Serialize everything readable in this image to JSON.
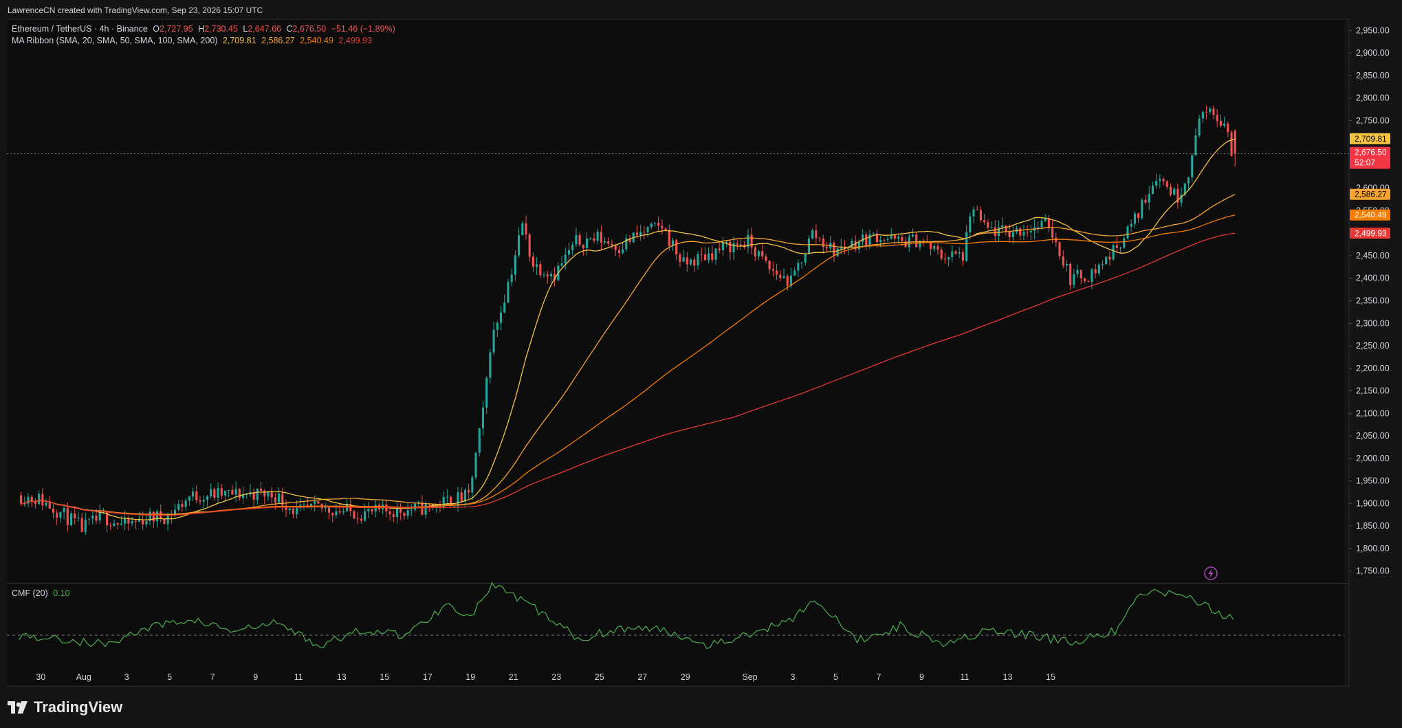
{
  "header": {
    "attribution": "LawrenceCN created with TradingView.com, Sep 23, 2026 15:07 UTC"
  },
  "legend": {
    "symbol": "Ethereum / TetherUS · 4h · Binance",
    "o_label": "O",
    "o_value": "2,727.95",
    "h_label": "H",
    "h_value": "2,730.45",
    "l_label": "L",
    "l_value": "2,647.66",
    "c_label": "C",
    "c_value": "2,676.50",
    "change": "−51.46 (−1.89%)",
    "ma_label": "MA Ribbon (SMA, 20, SMA, 50, SMA, 100, SMA, 200)",
    "ma_values": [
      "2,709.81",
      "2,586.27",
      "2,540.49",
      "2,499.93"
    ],
    "cmf_label": "CMF (20)",
    "cmf_value": "0.10"
  },
  "price_axis": {
    "ticks": [
      "2,950.00",
      "2,900.00",
      "2,850.00",
      "2,800.00",
      "2,750.00",
      "2,600.00",
      "2,550.00",
      "2,500.00",
      "2,450.00",
      "2,400.00",
      "2,350.00",
      "2,300.00",
      "2,250.00",
      "2,200.00",
      "2,150.00",
      "2,100.00",
      "2,050.00",
      "2,000.00",
      "1,950.00",
      "1,900.00",
      "1,850.00",
      "1,800.00",
      "1,750.00"
    ],
    "badges": [
      {
        "label": "2,709.81",
        "color": "#f5c542",
        "text_color": "#000000",
        "value": 2709.81
      },
      {
        "label": "2,676.50",
        "sub": "52:07",
        "color": "#f23645",
        "text_color": "#ffffff",
        "value": 2676.5
      },
      {
        "label": "2,586.27",
        "color": "#f7a530",
        "text_color": "#000000",
        "value": 2586.27
      },
      {
        "label": "2,540.49",
        "color": "#f57c00",
        "text_color": "#ffffff",
        "value": 2540.49
      },
      {
        "label": "2,499.93",
        "color": "#e53935",
        "text_color": "#ffffff",
        "value": 2499.93
      }
    ]
  },
  "time_axis": {
    "ticks": [
      "30",
      "Aug",
      "3",
      "5",
      "7",
      "9",
      "11",
      "13",
      "15",
      "17",
      "19",
      "21",
      "23",
      "25",
      "27",
      "29",
      "Sep",
      "3",
      "5",
      "7",
      "9",
      "11",
      "13",
      "15"
    ]
  },
  "branding": {
    "name": "TradingView"
  },
  "colors": {
    "up": "#26a69a",
    "down": "#ef5350",
    "sma20": "#f5c542",
    "sma50": "#f7a530",
    "sma100": "#f57c00",
    "sma200": "#e53935",
    "cmf": "#4caf50"
  },
  "chart_data": {
    "type": "candlestick",
    "symbol": "ETHUSDT",
    "interval": "4h",
    "ylim": [
      1725,
      2975
    ],
    "x_range": [
      "Jul 29",
      "Sep 23"
    ],
    "price_path": [
      [
        "Jul 29 00:00",
        1918
      ],
      [
        "Jul 30 00:00",
        1910
      ],
      [
        "Jul 31 00:00",
        1880
      ],
      [
        "Aug 1 00:00",
        1845
      ],
      [
        "Aug 2 00:00",
        1870
      ],
      [
        "Aug 3 00:00",
        1850
      ],
      [
        "Aug 4 00:00",
        1868
      ],
      [
        "Aug 5 00:00",
        1872
      ],
      [
        "Aug 6 00:00",
        1915
      ],
      [
        "Aug 7 00:00",
        1920
      ],
      [
        "Aug 8 00:00",
        1920
      ],
      [
        "Aug 9 00:00",
        1922
      ],
      [
        "Aug 10 00:00",
        1918
      ],
      [
        "Aug 11 00:00",
        1880
      ],
      [
        "Aug 12 00:00",
        1890
      ],
      [
        "Aug 13 00:00",
        1885
      ],
      [
        "Aug 14 00:00",
        1878
      ],
      [
        "Aug 15 00:00",
        1882
      ],
      [
        "Aug 16 00:00",
        1885
      ],
      [
        "Aug 17 00:00",
        1890
      ],
      [
        "Aug 18 00:00",
        1905
      ],
      [
        "Aug 19 00:00",
        1915
      ],
      [
        "Aug 19 16:00",
        2100
      ],
      [
        "Aug 20 00:00",
        2250
      ],
      [
        "Aug 20 16:00",
        2360
      ],
      [
        "Aug 21 00:00",
        2420
      ],
      [
        "Aug 21 12:00",
        2520
      ],
      [
        "Aug 22 00:00",
        2430
      ],
      [
        "Aug 23 00:00",
        2410
      ],
      [
        "Aug 24 00:00",
        2480
      ],
      [
        "Aug 25 00:00",
        2490
      ],
      [
        "Aug 26 00:00",
        2470
      ],
      [
        "Aug 27 00:00",
        2500
      ],
      [
        "Aug 28 00:00",
        2515
      ],
      [
        "Aug 29 00:00",
        2430
      ],
      [
        "Aug 30 00:00",
        2450
      ],
      [
        "Aug 31 00:00",
        2470
      ],
      [
        "Sep 1 00:00",
        2480
      ],
      [
        "Sep 2 00:00",
        2420
      ],
      [
        "Sep 3 00:00",
        2390
      ],
      [
        "Sep 4 00:00",
        2500
      ],
      [
        "Sep 5 00:00",
        2460
      ],
      [
        "Sep 6 00:00",
        2480
      ],
      [
        "Sep 7 00:00",
        2495
      ],
      [
        "Sep 8 00:00",
        2480
      ],
      [
        "Sep 9 00:00",
        2485
      ],
      [
        "Sep 10 00:00",
        2450
      ],
      [
        "Sep 11 00:00",
        2450
      ],
      [
        "Sep 11 12:00",
        2560
      ],
      [
        "Sep 12 00:00",
        2510
      ],
      [
        "Sep 13 00:00",
        2500
      ],
      [
        "Sep 14 00:00",
        2510
      ],
      [
        "Sep 15 00:00",
        2520
      ],
      [
        "Sep 16 00:00",
        2400
      ],
      [
        "Sep 17 00:00",
        2410
      ],
      [
        "Sep 18 00:00",
        2460
      ],
      [
        "Sep 19 00:00",
        2530
      ],
      [
        "Sep 20 00:00",
        2630
      ],
      [
        "Sep 21 00:00",
        2580
      ],
      [
        "Sep 21 16:00",
        2660
      ],
      [
        "Sep 22 00:00",
        2770
      ],
      [
        "Sep 23 00:00",
        2750
      ],
      [
        "Sep 23 08:00",
        2727.95
      ],
      [
        "Sep 23 12:00",
        2676.5
      ]
    ],
    "last_candle": {
      "open": 2727.95,
      "high": 2730.45,
      "low": 2647.66,
      "close": 2676.5
    },
    "series": [
      {
        "name": "SMA 20",
        "last": 2709.81
      },
      {
        "name": "SMA 50",
        "last": 2586.27
      },
      {
        "name": "SMA 100",
        "last": 2540.49
      },
      {
        "name": "SMA 200",
        "last": 2499.93
      }
    ],
    "indicator": {
      "name": "CMF (20)",
      "last": 0.1,
      "path": [
        [
          "Jul 29",
          0.0
        ],
        [
          "Aug 2",
          -0.05
        ],
        [
          "Aug 4",
          0.04
        ],
        [
          "Aug 6",
          0.09
        ],
        [
          "Aug 8",
          0.02
        ],
        [
          "Aug 10",
          0.07
        ],
        [
          "Aug 12",
          -0.06
        ],
        [
          "Aug 14",
          0.03
        ],
        [
          "Aug 16",
          0.0
        ],
        [
          "Aug 18",
          0.18
        ],
        [
          "Aug 19",
          0.1
        ],
        [
          "Aug 20",
          0.28
        ],
        [
          "Aug 22",
          0.15
        ],
        [
          "Aug 24",
          -0.02
        ],
        [
          "Aug 26",
          0.04
        ],
        [
          "Aug 28",
          0.03
        ],
        [
          "Aug 30",
          -0.05
        ],
        [
          "Sep 1",
          0.0
        ],
        [
          "Sep 3",
          0.1
        ],
        [
          "Sep 4",
          0.2
        ],
        [
          "Sep 6",
          -0.03
        ],
        [
          "Sep 8",
          0.05
        ],
        [
          "Sep 10",
          -0.04
        ],
        [
          "Sep 12",
          0.02
        ],
        [
          "Sep 14",
          0.0
        ],
        [
          "Sep 16",
          -0.04
        ],
        [
          "Sep 18",
          0.02
        ],
        [
          "Sep 19",
          0.2
        ],
        [
          "Sep 20",
          0.25
        ],
        [
          "Sep 21",
          0.22
        ],
        [
          "Sep 22",
          0.18
        ],
        [
          "Sep 23",
          0.1
        ]
      ]
    }
  }
}
